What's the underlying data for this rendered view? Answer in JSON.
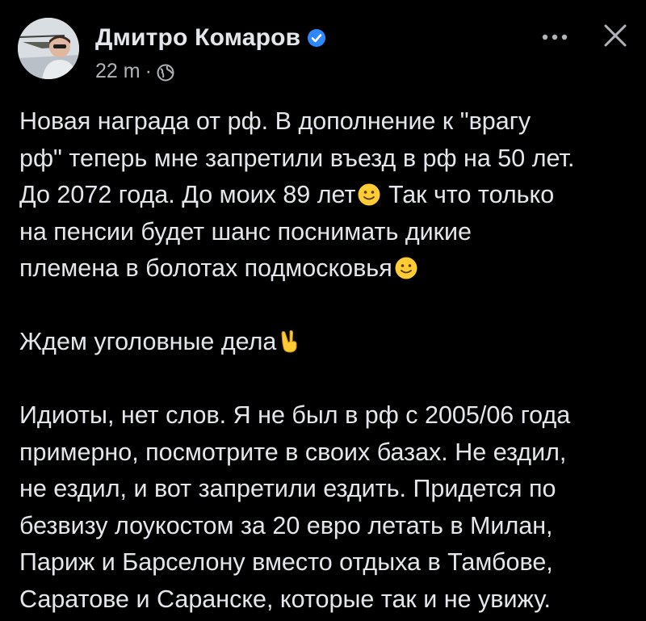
{
  "post": {
    "author": "Дмитро Комаров",
    "time": "22 m",
    "separator": "·",
    "icons": {
      "verified": "verified-badge-icon",
      "audience": "globe-icon",
      "more": "more-horizontal-icon",
      "close": "close-icon",
      "smile": "slightly-smiling-face-emoji",
      "victory": "victory-hand-emoji"
    },
    "colors": {
      "background": "#000000",
      "text": "#e4e6eb",
      "secondary": "#b0b3b8",
      "verified": "#2d88ff"
    },
    "p1_l1": "Новая награда от рф. В дополнение к \"врагу",
    "p1_l2": "рф\" теперь мне запретили въезд в рф на 50 лет.",
    "p1_l3a": "До 2072 года. До моих 89 лет",
    "p1_l3b": " Так что только",
    "p1_l4": "на пенсии будет шанс поснимать дикие",
    "p1_l5": "племена в болотах подмосковья",
    "p2": "Ждем уголовные дела",
    "p3_l1": "Идиоты, нет слов. Я не был в рф с 2005/06 года",
    "p3_l2": "примерно, посмотрите в своих базах. Не ездил,",
    "p3_l3": "не ездил, и вот запретили ездить. Придется по",
    "p3_l4": "безвизу лоукостом за 20 евро летать в Милан,",
    "p3_l5": "Париж и Барселону вместо отдыха в Тамбове,",
    "p3_l6": "Саратове и Саранске, которые так и не увижу."
  }
}
